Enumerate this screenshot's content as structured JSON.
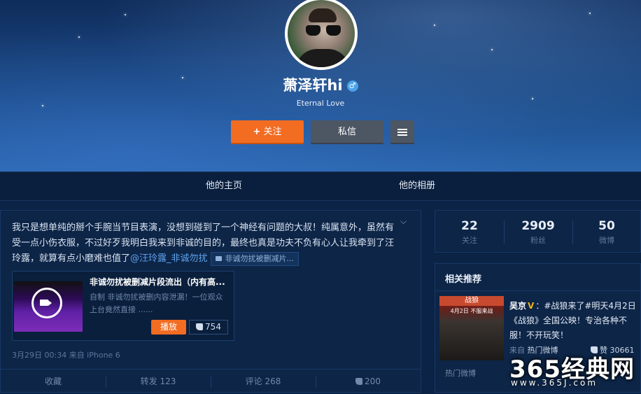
{
  "profile": {
    "name": "萧泽轩hi",
    "gender_symbol": "♂",
    "motto": "Eternal Love",
    "follow_label": "关注",
    "message_label": "私信"
  },
  "nav": {
    "home": "他的主页",
    "album": "他的相册"
  },
  "post": {
    "text_main": "我只是想单纯的掰个手腕当节目表演，没想到碰到了一个神经有问题的大叔！纯属意外，虽然有受一点小伤衣服，不过好歹我明白我来到非诚的目的，最终也真是功夫不负有心人让我牵到了汪玲露，就算有点小磨难也值了",
    "mention": "@汪玲露_非诚勿扰",
    "video_tag": "非诚勿扰被删减片...",
    "media": {
      "title": "非诚勿扰被删减片段流出（内有高...",
      "description": "自制 非诚勿扰被删内容泄漏！一位观众上台竟然直接 ......",
      "play_label": "播放",
      "likes": "754"
    },
    "meta": "3月29日 00:34 来自 iPhone 6",
    "actions": {
      "favorite": "收藏",
      "repost": "转发 123",
      "comment": "评论 268",
      "like": "200"
    }
  },
  "stats": [
    {
      "value": "22",
      "label": "关注"
    },
    {
      "value": "2909",
      "label": "粉丝"
    },
    {
      "value": "50",
      "label": "微博"
    }
  ],
  "recommend": {
    "title": "相关推荐",
    "poster_title": "战狼",
    "poster_sub": "4月2日 不服来战",
    "user": "吴京",
    "verified": "V",
    "text": "：#战狼来了#明天4月2日《战狼》全国公映！专治各种不服！不开玩笑！",
    "from_prefix": "来自",
    "from_source": "热门微博",
    "likes": "赞 30661",
    "hot_label": "热门微博"
  },
  "watermark": {
    "brand": "365经典网",
    "url": "www.365J.com"
  },
  "colors": {
    "accent_orange": "#f26c22",
    "button_gray": "#4d5663",
    "link_blue": "#5ea3ee",
    "verified_gold": "#f2b318"
  }
}
